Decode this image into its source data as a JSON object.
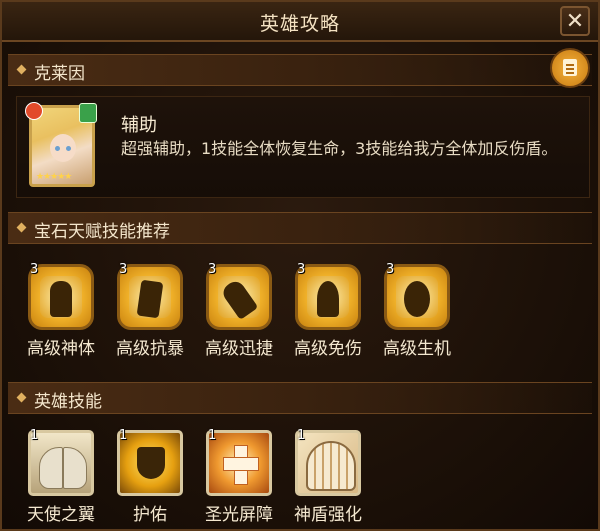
{
  "window": {
    "title": "英雄攻略",
    "close_label": "✕"
  },
  "hero_section": {
    "heading": "克莱因",
    "note_icon": "notebook-icon"
  },
  "hero": {
    "portrait_icon": "hero-portrait",
    "stars": "★★★★★",
    "type": "辅助",
    "description": "超强辅助，1技能全体恢复生命，3技能给我方全体加反伤盾。"
  },
  "gem_section": {
    "heading": "宝石天赋技能推荐",
    "items": [
      {
        "level": "3",
        "name": "高级神体",
        "icon": "body-silhouette-icon"
      },
      {
        "level": "3",
        "name": "高级抗暴",
        "icon": "crit-resist-icon"
      },
      {
        "level": "3",
        "name": "高级迅捷",
        "icon": "swift-icon"
      },
      {
        "level": "3",
        "name": "高级免伤",
        "icon": "damage-reduction-icon"
      },
      {
        "level": "3",
        "name": "高级生机",
        "icon": "vitality-icon"
      }
    ]
  },
  "skill_section": {
    "heading": "英雄技能",
    "items": [
      {
        "level": "1",
        "name": "天使之翼",
        "icon": "angel-wings-icon"
      },
      {
        "level": "1",
        "name": "护佑",
        "icon": "golden-shield-icon"
      },
      {
        "level": "1",
        "name": "圣光屏障",
        "icon": "holy-cross-icon"
      },
      {
        "level": "1",
        "name": "神盾强化",
        "icon": "aegis-fan-icon"
      }
    ]
  },
  "colors": {
    "accent": "#e0b060",
    "gold": "#f4b62c",
    "text": "#f3e6cf"
  }
}
